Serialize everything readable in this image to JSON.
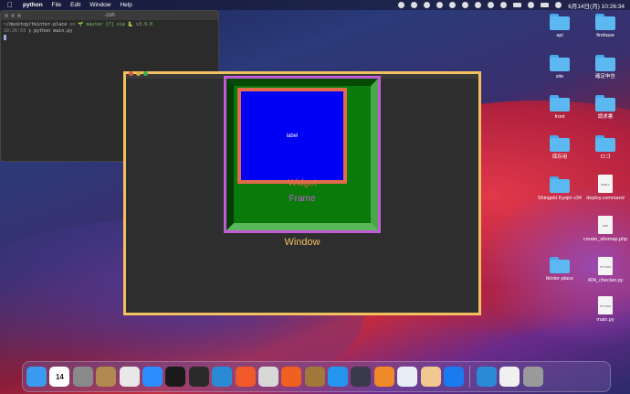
{
  "menubar": {
    "app_name": "python",
    "items": [
      "File",
      "Edit",
      "Window",
      "Help"
    ],
    "clock": "6月14日(月)  10:26:34"
  },
  "terminal": {
    "title": "-zsh",
    "line1_path": "~/desktop/tkinter-place",
    "line1_on": "on",
    "line1_branch": "🌱 master [?] via 🐍 v3.9.0",
    "line2_time": "10:26:03",
    "line2_cmd": "❯ python main.py"
  },
  "tk_window": {
    "widget_label": "label",
    "widget_caption": "Widget",
    "frame_caption": "Frame",
    "window_caption": "Window",
    "colors": {
      "window_border": "#f3c060",
      "frame_border": "#c45ad8",
      "frame_fill": "#0a7a0a",
      "widget_border": "#e36a4a",
      "widget_fill": "#0000f5"
    }
  },
  "desktop_icons": [
    {
      "label": "api",
      "kind": "folder"
    },
    {
      "label": "firebase",
      "kind": "folder"
    },
    {
      "label": "site",
      "kind": "folder"
    },
    {
      "label": "確定申告",
      "kind": "folder"
    },
    {
      "label": "front",
      "kind": "folder"
    },
    {
      "label": "請求書",
      "kind": "folder"
    },
    {
      "label": "保存用",
      "kind": "folder"
    },
    {
      "label": "ロゴ",
      "kind": "folder"
    },
    {
      "label": "Shingeki Kyojin v34",
      "kind": "folder"
    },
    {
      "label": "deploy.command",
      "kind": "doc",
      "badge": "SHELL"
    },
    {
      "label": "create_sitemap.php",
      "kind": "doc",
      "badge": "PHP"
    },
    {
      "label": "tkinter-place",
      "kind": "folder"
    },
    {
      "label": "404_checker.py",
      "kind": "doc",
      "badge": "PYTHON"
    },
    {
      "label": "main.py",
      "kind": "doc",
      "badge": "PYTHON"
    }
  ],
  "dock": {
    "apps": [
      {
        "name": "finder-icon",
        "color": "#3a9af0"
      },
      {
        "name": "calendar-icon",
        "color": "#ffffff",
        "text": "14"
      },
      {
        "name": "system-preferences-icon",
        "color": "#8a8a8a"
      },
      {
        "name": "archive-icon",
        "color": "#b08a50"
      },
      {
        "name": "chrome-icon",
        "color": "#e8e8e8"
      },
      {
        "name": "zoom-icon",
        "color": "#2d8cff"
      },
      {
        "name": "iterm-icon",
        "color": "#1a1a1a"
      },
      {
        "name": "terminal-icon",
        "color": "#2a2a2a"
      },
      {
        "name": "vscode-icon",
        "color": "#2a8ad6"
      },
      {
        "name": "safari-like-icon",
        "color": "#f05a2a"
      },
      {
        "name": "sequel-icon",
        "color": "#d8d8d8"
      },
      {
        "name": "stats-icon",
        "color": "#f06020"
      },
      {
        "name": "box-icon",
        "color": "#a0783a"
      },
      {
        "name": "docker-icon",
        "color": "#2496ed"
      },
      {
        "name": "quicktime-icon",
        "color": "#3a3a4a"
      },
      {
        "name": "sourcetree-icon",
        "color": "#f08a2a"
      },
      {
        "name": "preview-icon",
        "color": "#e8eef8"
      },
      {
        "name": "python-launcher-icon",
        "color": "#f0c890"
      },
      {
        "name": "infinity-icon",
        "color": "#1a7af0"
      },
      {
        "name": "vscode-2-icon",
        "color": "#2a8ad6"
      },
      {
        "name": "document-icon",
        "color": "#f0f0f0"
      },
      {
        "name": "trash-icon",
        "color": "#9a9a9a"
      }
    ]
  }
}
